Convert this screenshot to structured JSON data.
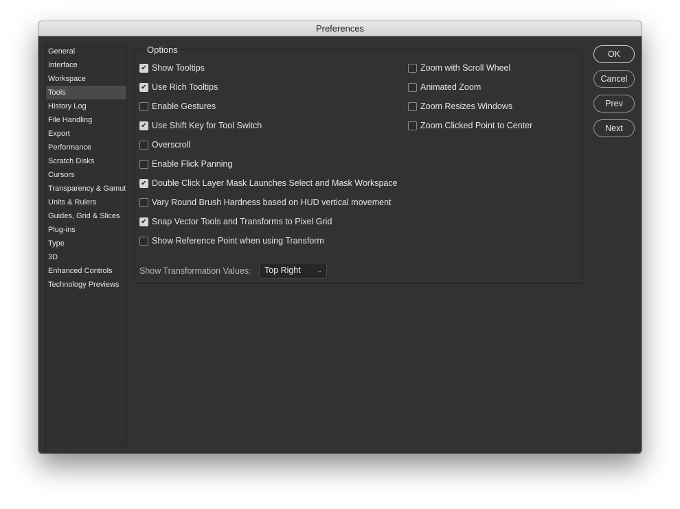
{
  "window": {
    "title": "Preferences"
  },
  "sidebar": {
    "items": [
      "General",
      "Interface",
      "Workspace",
      "Tools",
      "History Log",
      "File Handling",
      "Export",
      "Performance",
      "Scratch Disks",
      "Cursors",
      "Transparency & Gamut",
      "Units & Rulers",
      "Guides, Grid & Slices",
      "Plug-ins",
      "Type",
      "3D",
      "Enhanced Controls",
      "Technology Previews"
    ],
    "selected": "Tools"
  },
  "options": {
    "legend": "Options",
    "left": [
      {
        "label": "Show Tooltips",
        "checked": true
      },
      {
        "label": "Use Rich Tooltips",
        "checked": true
      },
      {
        "label": "Enable Gestures",
        "checked": false
      },
      {
        "label": "Use Shift Key for Tool Switch",
        "checked": true
      },
      {
        "label": "Overscroll",
        "checked": false
      },
      {
        "label": "Enable Flick Panning",
        "checked": false
      },
      {
        "label": "Double Click Layer Mask Launches Select and Mask Workspace",
        "checked": true
      },
      {
        "label": "Vary Round Brush Hardness based on HUD vertical movement",
        "checked": false
      },
      {
        "label": "Snap Vector Tools and Transforms to Pixel Grid",
        "checked": true
      },
      {
        "label": "Show Reference Point when using Transform",
        "checked": false
      }
    ],
    "right": [
      {
        "label": "Zoom with Scroll Wheel",
        "checked": false
      },
      {
        "label": "Animated Zoom",
        "checked": false
      },
      {
        "label": "Zoom Resizes Windows",
        "checked": false
      },
      {
        "label": "Zoom Clicked Point to Center",
        "checked": false
      }
    ],
    "transform_label": "Show Transformation Values:",
    "transform_value": "Top Right"
  },
  "buttons": {
    "ok": "OK",
    "cancel": "Cancel",
    "prev": "Prev",
    "next": "Next"
  }
}
